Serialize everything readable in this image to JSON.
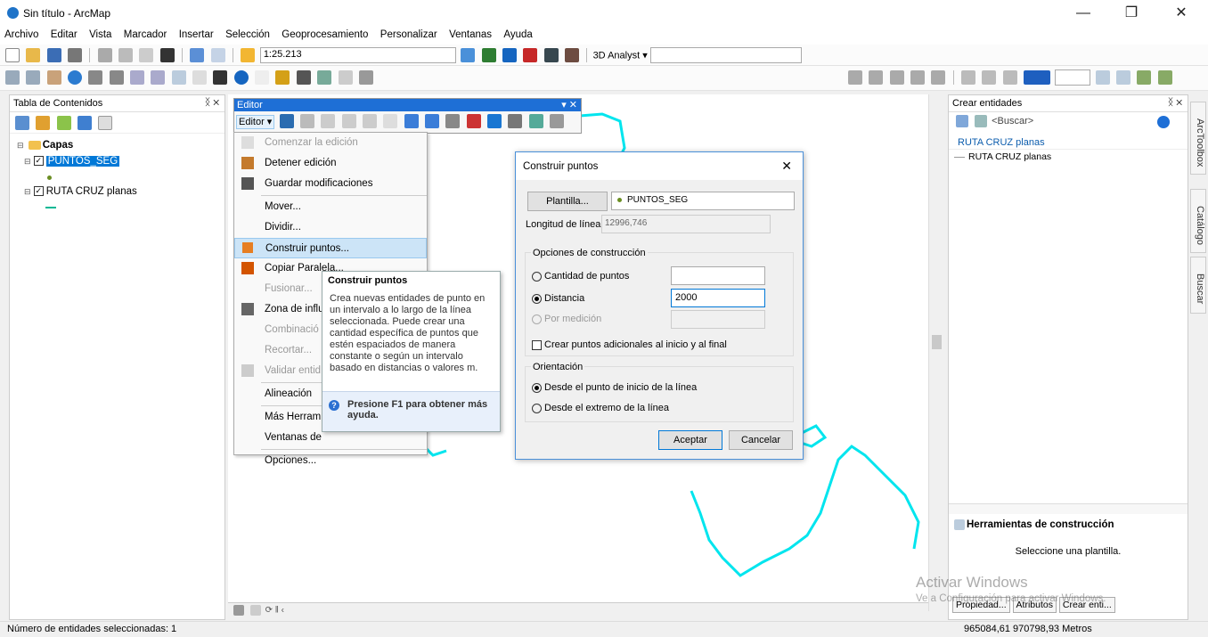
{
  "window": {
    "title": "Sin título - ArcMap",
    "minimize": "—",
    "maximize": "❐",
    "close": "✕"
  },
  "menubar": [
    "Archivo",
    "Editar",
    "Vista",
    "Marcador",
    "Insertar",
    "Selección",
    "Geoprocesamiento",
    "Personalizar",
    "Ventanas",
    "Ayuda"
  ],
  "toolbar": {
    "scale": "1:25.213",
    "analyst": "3D Analyst ▾"
  },
  "toc": {
    "title": "Tabla de Contenidos",
    "pin": "ᛝ ✕",
    "group": "Capas",
    "layers": [
      {
        "name": "PUNTOS_SEG"
      },
      {
        "name": "RUTA CRUZ planas"
      }
    ]
  },
  "editor": {
    "title": "Editor",
    "menu_label": "Editor ▾",
    "items": [
      {
        "label": "Comenzar la edición",
        "enabled": false
      },
      {
        "label": "Detener edición",
        "enabled": true
      },
      {
        "label": "Guardar modificaciones",
        "enabled": true
      },
      {
        "label": "Mover...",
        "enabled": true
      },
      {
        "label": "Dividir...",
        "enabled": true
      },
      {
        "label": "Construir puntos...",
        "enabled": true,
        "selected": true
      },
      {
        "label": "Copiar Paralela...",
        "enabled": true
      },
      {
        "label": "Fusionar...",
        "enabled": false
      },
      {
        "label": "Zona de influ",
        "enabled": true
      },
      {
        "label": "Combinació",
        "enabled": false
      },
      {
        "label": "Recortar...",
        "enabled": false
      },
      {
        "label": "Validar entid",
        "enabled": false
      },
      {
        "label": "Alineación",
        "enabled": true
      },
      {
        "label": "Más Herram",
        "enabled": true
      },
      {
        "label": "Ventanas de",
        "enabled": true
      },
      {
        "label": "Opciones...",
        "enabled": true
      }
    ]
  },
  "tooltip": {
    "title": "Construir puntos",
    "body": "Crea nuevas entidades de punto en un intervalo a lo largo de la línea seleccionada. Puede crear una cantidad específica de puntos que estén espaciados de manera constante o según un intervalo basado en distancias o valores m.",
    "help": "Presione F1 para obtener más ayuda."
  },
  "dialog": {
    "title": "Construir puntos",
    "close": "✕",
    "template_button": "Plantilla...",
    "template_value": "PUNTOS_SEG",
    "line_length_label": "Longitud de línea:",
    "line_length_value": "12996,746",
    "construction_group": "Opciones de construcción",
    "opt_count": "Cantidad de puntos",
    "opt_distance": "Distancia",
    "distance_value": "2000",
    "opt_measure": "Por medición",
    "extra_points": "Crear puntos adicionales al inicio y al final",
    "orientation_group": "Orientación",
    "orient_start": "Desde el punto de inicio de la línea",
    "orient_end": "Desde el extremo de la línea",
    "accept": "Aceptar",
    "cancel": "Cancelar"
  },
  "create_features": {
    "title": "Crear entidades",
    "search": "<Buscar>",
    "group": "RUTA CRUZ planas",
    "item": "RUTA CRUZ planas",
    "construction_title": "Herramientas de construcción",
    "construction_msg": "Seleccione una plantilla.",
    "btn_properties": "Propiedad...",
    "btn_attributes": "Atributos",
    "btn_create": "Crear enti..."
  },
  "side_tabs": [
    "ArcToolbox",
    "Catálogo",
    "Buscar"
  ],
  "watermark": {
    "line1": "Activar Windows",
    "line2": "Ve a Configuración para activar Windows."
  },
  "status": {
    "selected": "Número de entidades seleccionadas: 1",
    "coords": "965084,61  970798,93 Metros"
  },
  "colors": {
    "route": "#00e5ee",
    "highlight": "#0078d7",
    "point": "#6b8e23"
  }
}
